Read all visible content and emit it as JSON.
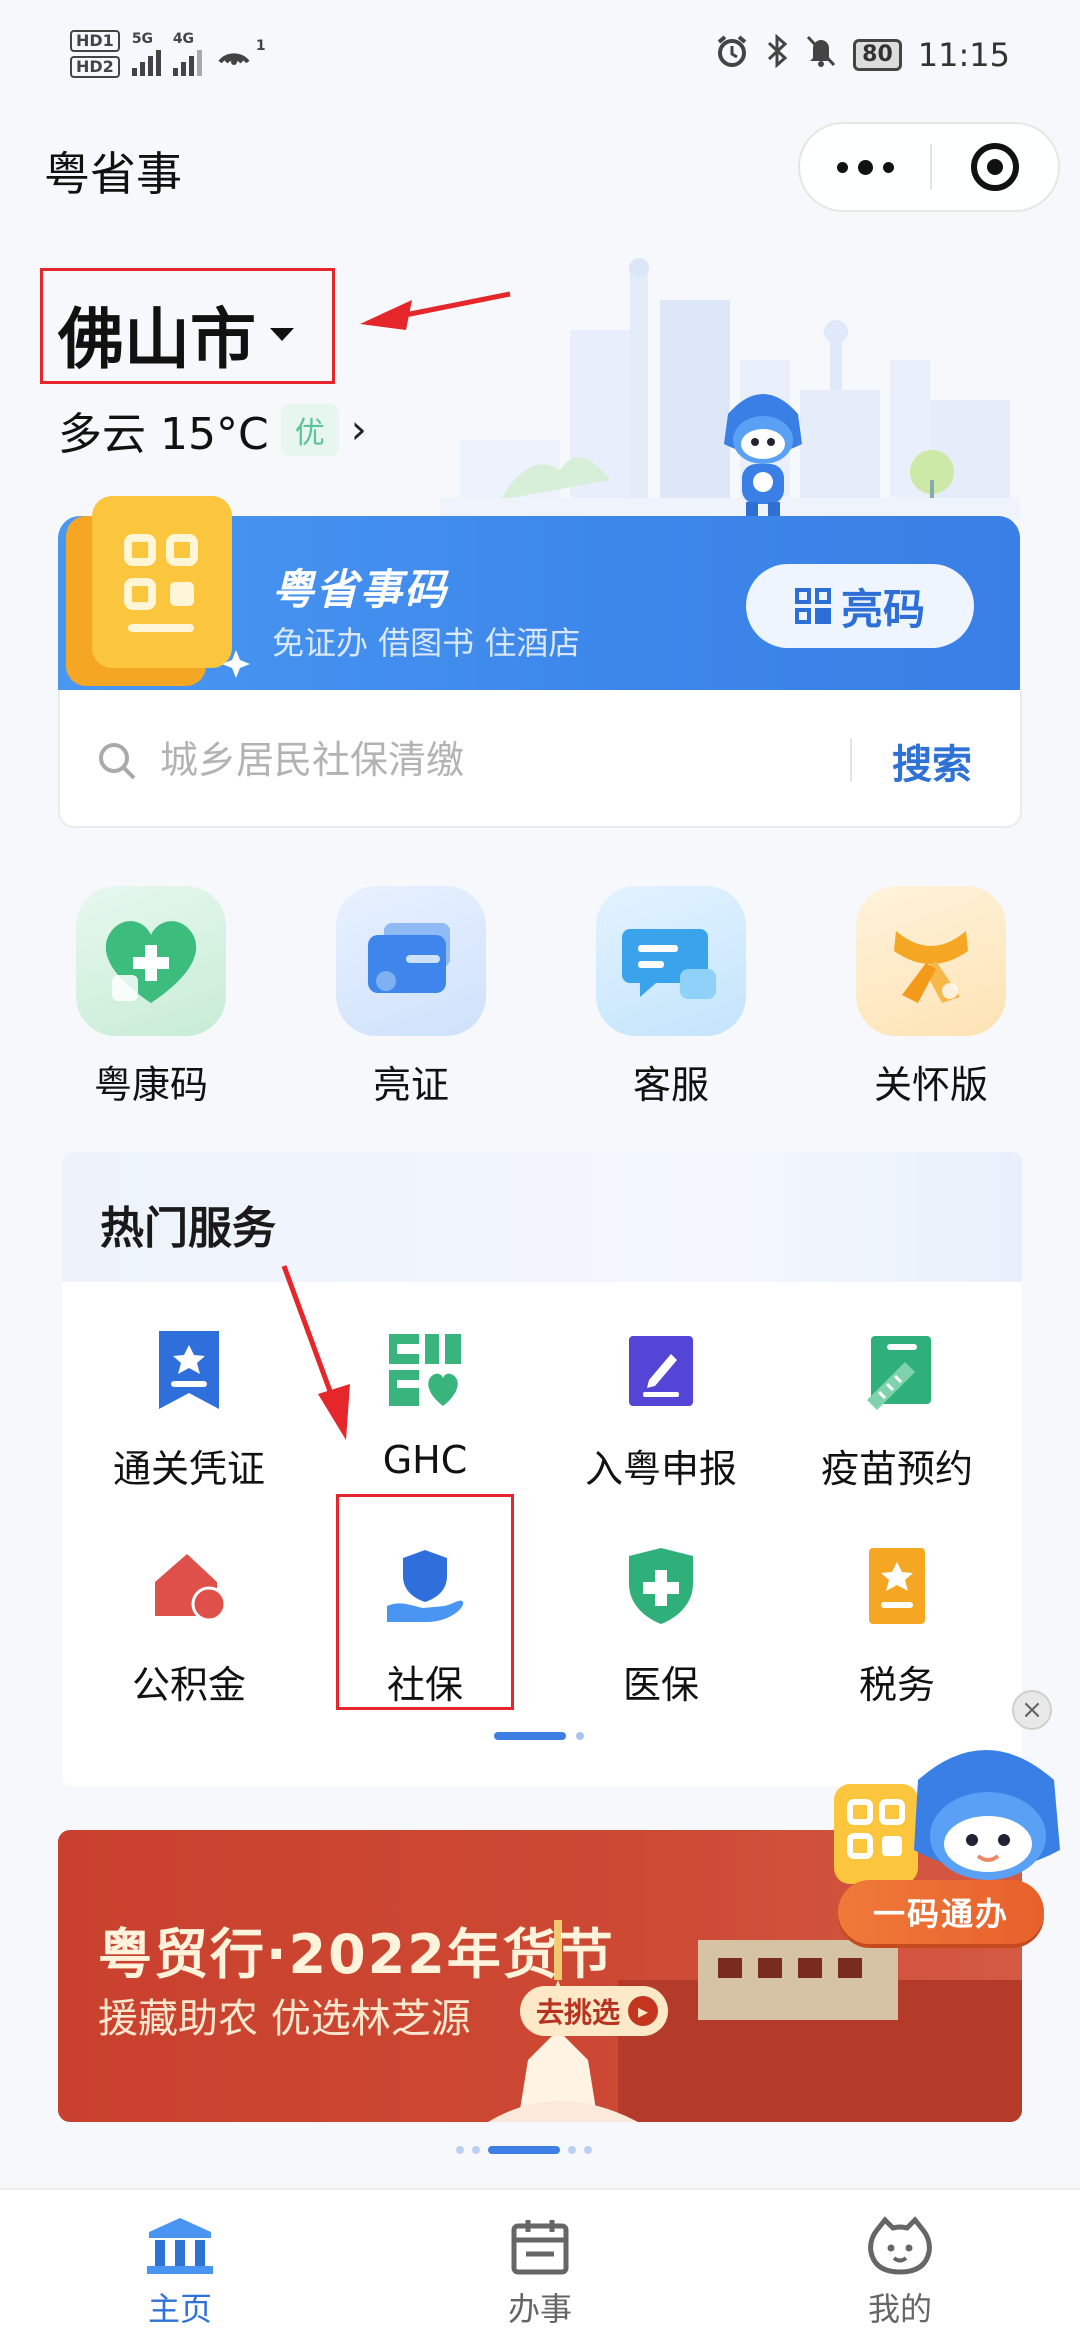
{
  "status_bar": {
    "hd1": "HD",
    "hd1_sub": "1",
    "hd2": "HD",
    "hd2_sub": "2",
    "net1": "5G",
    "net2": "4G",
    "hotspot_count": "1",
    "battery": "80",
    "time": "11:15",
    "icons": [
      "alarm-icon",
      "bluetooth-icon",
      "mute-icon"
    ]
  },
  "header": {
    "app_title": "粤省事",
    "more_icon": "more-dots-icon",
    "close_icon": "target-icon"
  },
  "location": {
    "city": "佛山市",
    "weather": "多云 15°C",
    "aqi": "优"
  },
  "code_card": {
    "title": "粤省事码",
    "subtitle": "免证办 借图书 住酒店",
    "button_label": "亮码"
  },
  "search": {
    "placeholder": "城乡居民社保清缴",
    "button_label": "搜索"
  },
  "quick_entries": [
    {
      "label": "粤康码",
      "icon": "health-heart-icon"
    },
    {
      "label": "亮证",
      "icon": "card-wallet-icon"
    },
    {
      "label": "客服",
      "icon": "chat-bubble-icon"
    },
    {
      "label": "关怀版",
      "icon": "scarf-icon"
    }
  ],
  "hot_services": {
    "title": "热门服务",
    "items": [
      {
        "label": "通关凭证",
        "icon": "ribbon-certificate-icon"
      },
      {
        "label": "GHC",
        "icon": "ghc-logo-icon"
      },
      {
        "label": "入粤申报",
        "icon": "pencil-report-icon"
      },
      {
        "label": "疫苗预约",
        "icon": "syringe-icon"
      },
      {
        "label": "公积金",
        "icon": "house-coin-icon"
      },
      {
        "label": "社保",
        "icon": "hand-shield-icon"
      },
      {
        "label": "医保",
        "icon": "medical-shield-icon"
      },
      {
        "label": "税务",
        "icon": "tax-document-icon"
      }
    ]
  },
  "float_widget": {
    "label": "一码通办",
    "close_icon": "close-icon"
  },
  "banner": {
    "title": "粤贸行·2022年货节",
    "subtitle": "援藏助农 优选林芝源",
    "button_label": "去挑选"
  },
  "tab_bar": [
    {
      "label": "主页",
      "icon": "home-building-icon",
      "active": true
    },
    {
      "label": "办事",
      "icon": "calendar-icon",
      "active": false
    },
    {
      "label": "我的",
      "icon": "mascot-face-icon",
      "active": false
    }
  ],
  "colors": {
    "accent": "#2f72d6",
    "highlight": "#e5262a",
    "banner": "#c9412e"
  }
}
